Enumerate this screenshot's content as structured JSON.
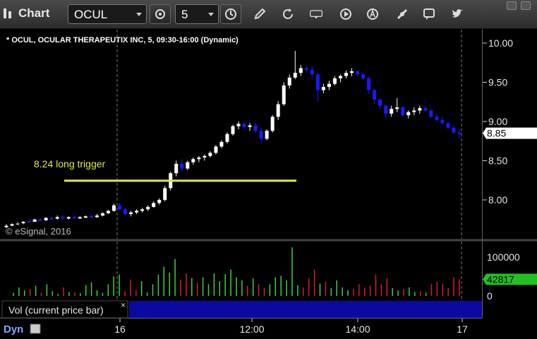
{
  "toolbar": {
    "title": "Chart",
    "symbol": "OCUL",
    "interval": "5"
  },
  "chart": {
    "header": "* OCUL, OCULAR THERAPEUTIX INC, 5, 09:30-16:00 (Dynamic)",
    "copyright": "© eSignal, 2016",
    "annotation": "8.24 long trigger",
    "last_price_label": "8.85",
    "volume_pane_label": "Vol (current price bar)",
    "last_volume_label": "42817",
    "dyn_label": "Dyn",
    "close_x": "×"
  },
  "colors": {
    "up": "#ffffff",
    "down": "#1a1aff",
    "doji": "#aaaaaa",
    "vol_up": "#3fcf3f",
    "vol_down": "#d42020",
    "trigger": "#e4ec3a",
    "badge_vol": "#22c022"
  },
  "chart_data": [
    {
      "type": "candlestick",
      "price_axis": {
        "ticks": [
          "10.00",
          "9.50",
          "9.00",
          "8.50",
          "8.00"
        ],
        "ylim": [
          7.6,
          10.1
        ]
      },
      "time_axis": {
        "ticks": [
          "16",
          "12:00",
          "14:00",
          "17"
        ]
      },
      "trigger_level": 8.24,
      "bars": [
        {
          "o": 7.66,
          "h": 7.69,
          "l": 7.64,
          "c": 7.67
        },
        {
          "o": 7.68,
          "h": 7.7,
          "l": 7.66,
          "c": 7.69
        },
        {
          "o": 7.7,
          "h": 7.72,
          "l": 7.68,
          "c": 7.7
        },
        {
          "o": 7.71,
          "h": 7.73,
          "l": 7.69,
          "c": 7.72
        },
        {
          "o": 7.73,
          "h": 7.75,
          "l": 7.71,
          "c": 7.72
        },
        {
          "o": 7.72,
          "h": 7.76,
          "l": 7.72,
          "c": 7.75
        },
        {
          "o": 7.75,
          "h": 7.77,
          "l": 7.73,
          "c": 7.74
        },
        {
          "o": 7.74,
          "h": 7.78,
          "l": 7.73,
          "c": 7.77
        },
        {
          "o": 7.77,
          "h": 7.79,
          "l": 7.75,
          "c": 7.76
        },
        {
          "o": 7.76,
          "h": 7.8,
          "l": 7.75,
          "c": 7.78
        },
        {
          "o": 7.78,
          "h": 7.8,
          "l": 7.76,
          "c": 7.77
        },
        {
          "o": 7.77,
          "h": 7.79,
          "l": 7.75,
          "c": 7.78
        },
        {
          "o": 7.78,
          "h": 7.8,
          "l": 7.77,
          "c": 7.77
        },
        {
          "o": 7.77,
          "h": 7.79,
          "l": 7.76,
          "c": 7.78
        },
        {
          "o": 7.78,
          "h": 7.8,
          "l": 7.77,
          "c": 7.79
        },
        {
          "o": 7.79,
          "h": 7.81,
          "l": 7.77,
          "c": 7.78
        },
        {
          "o": 7.78,
          "h": 7.82,
          "l": 7.77,
          "c": 7.8
        },
        {
          "o": 7.8,
          "h": 7.84,
          "l": 7.79,
          "c": 7.83
        },
        {
          "o": 7.83,
          "h": 7.87,
          "l": 7.82,
          "c": 7.86
        },
        {
          "o": 7.86,
          "h": 7.95,
          "l": 7.85,
          "c": 7.93
        },
        {
          "o": 7.93,
          "h": 7.96,
          "l": 7.86,
          "c": 7.88
        },
        {
          "o": 7.88,
          "h": 7.9,
          "l": 7.8,
          "c": 7.82
        },
        {
          "o": 7.82,
          "h": 7.86,
          "l": 7.79,
          "c": 7.84
        },
        {
          "o": 7.84,
          "h": 7.88,
          "l": 7.82,
          "c": 7.86
        },
        {
          "o": 7.86,
          "h": 7.9,
          "l": 7.84,
          "c": 7.88
        },
        {
          "o": 7.88,
          "h": 7.93,
          "l": 7.86,
          "c": 7.91
        },
        {
          "o": 7.91,
          "h": 7.98,
          "l": 7.9,
          "c": 7.96
        },
        {
          "o": 7.96,
          "h": 8.02,
          "l": 7.94,
          "c": 8.0
        },
        {
          "o": 8.0,
          "h": 8.18,
          "l": 7.98,
          "c": 8.15
        },
        {
          "o": 8.15,
          "h": 8.36,
          "l": 8.12,
          "c": 8.34
        },
        {
          "o": 8.34,
          "h": 8.5,
          "l": 8.3,
          "c": 8.46
        },
        {
          "o": 8.46,
          "h": 8.52,
          "l": 8.36,
          "c": 8.4
        },
        {
          "o": 8.4,
          "h": 8.5,
          "l": 8.38,
          "c": 8.48
        },
        {
          "o": 8.48,
          "h": 8.54,
          "l": 8.45,
          "c": 8.52
        },
        {
          "o": 8.52,
          "h": 8.56,
          "l": 8.48,
          "c": 8.54
        },
        {
          "o": 8.54,
          "h": 8.58,
          "l": 8.5,
          "c": 8.56
        },
        {
          "o": 8.56,
          "h": 8.62,
          "l": 8.54,
          "c": 8.6
        },
        {
          "o": 8.6,
          "h": 8.7,
          "l": 8.58,
          "c": 8.68
        },
        {
          "o": 8.68,
          "h": 8.76,
          "l": 8.66,
          "c": 8.74
        },
        {
          "o": 8.74,
          "h": 8.86,
          "l": 8.72,
          "c": 8.84
        },
        {
          "o": 8.84,
          "h": 8.96,
          "l": 8.82,
          "c": 8.94
        },
        {
          "o": 8.94,
          "h": 9.0,
          "l": 8.9,
          "c": 8.97
        },
        {
          "o": 8.97,
          "h": 9.0,
          "l": 8.9,
          "c": 8.93
        },
        {
          "o": 8.93,
          "h": 8.98,
          "l": 8.88,
          "c": 8.95
        },
        {
          "o": 8.95,
          "h": 8.98,
          "l": 8.86,
          "c": 8.88
        },
        {
          "o": 8.88,
          "h": 8.92,
          "l": 8.72,
          "c": 8.78
        },
        {
          "o": 8.78,
          "h": 8.9,
          "l": 8.76,
          "c": 8.88
        },
        {
          "o": 8.88,
          "h": 9.08,
          "l": 8.86,
          "c": 9.06
        },
        {
          "o": 9.06,
          "h": 9.26,
          "l": 9.02,
          "c": 9.22
        },
        {
          "o": 9.22,
          "h": 9.5,
          "l": 9.2,
          "c": 9.46
        },
        {
          "o": 9.46,
          "h": 9.6,
          "l": 9.42,
          "c": 9.56
        },
        {
          "o": 9.56,
          "h": 9.9,
          "l": 9.54,
          "c": 9.62
        },
        {
          "o": 9.62,
          "h": 9.72,
          "l": 9.58,
          "c": 9.68
        },
        {
          "o": 9.68,
          "h": 9.72,
          "l": 9.62,
          "c": 9.66
        },
        {
          "o": 9.66,
          "h": 9.7,
          "l": 9.56,
          "c": 9.6
        },
        {
          "o": 9.6,
          "h": 9.62,
          "l": 9.25,
          "c": 9.4
        },
        {
          "o": 9.4,
          "h": 9.48,
          "l": 9.36,
          "c": 9.44
        },
        {
          "o": 9.44,
          "h": 9.52,
          "l": 9.4,
          "c": 9.48
        },
        {
          "o": 9.48,
          "h": 9.58,
          "l": 9.46,
          "c": 9.55
        },
        {
          "o": 9.55,
          "h": 9.6,
          "l": 9.5,
          "c": 9.58
        },
        {
          "o": 9.58,
          "h": 9.65,
          "l": 9.55,
          "c": 9.62
        },
        {
          "o": 9.62,
          "h": 9.68,
          "l": 9.58,
          "c": 9.64
        },
        {
          "o": 9.64,
          "h": 9.66,
          "l": 9.58,
          "c": 9.6
        },
        {
          "o": 9.6,
          "h": 9.64,
          "l": 9.52,
          "c": 9.55
        },
        {
          "o": 9.55,
          "h": 9.58,
          "l": 9.35,
          "c": 9.4
        },
        {
          "o": 9.4,
          "h": 9.42,
          "l": 9.22,
          "c": 9.28
        },
        {
          "o": 9.28,
          "h": 9.3,
          "l": 9.15,
          "c": 9.2
        },
        {
          "o": 9.2,
          "h": 9.22,
          "l": 9.04,
          "c": 9.1
        },
        {
          "o": 9.1,
          "h": 9.2,
          "l": 9.06,
          "c": 9.16
        },
        {
          "o": 9.16,
          "h": 9.3,
          "l": 9.12,
          "c": 9.18
        },
        {
          "o": 9.18,
          "h": 9.2,
          "l": 9.05,
          "c": 9.08
        },
        {
          "o": 9.08,
          "h": 9.14,
          "l": 9.04,
          "c": 9.12
        },
        {
          "o": 9.12,
          "h": 9.18,
          "l": 9.08,
          "c": 9.14
        },
        {
          "o": 9.14,
          "h": 9.2,
          "l": 9.1,
          "c": 9.17
        },
        {
          "o": 9.17,
          "h": 9.2,
          "l": 9.12,
          "c": 9.14
        },
        {
          "o": 9.14,
          "h": 9.16,
          "l": 9.04,
          "c": 9.06
        },
        {
          "o": 9.06,
          "h": 9.1,
          "l": 9.0,
          "c": 9.02
        },
        {
          "o": 9.02,
          "h": 9.06,
          "l": 8.96,
          "c": 8.98
        },
        {
          "o": 8.98,
          "h": 9.0,
          "l": 8.9,
          "c": 8.92
        },
        {
          "o": 8.92,
          "h": 8.95,
          "l": 8.84,
          "c": 8.86
        },
        {
          "o": 8.86,
          "h": 8.9,
          "l": 8.78,
          "c": 8.85
        }
      ],
      "volume_axis": {
        "ticks": [
          "100000",
          "0"
        ],
        "ylim": [
          0,
          125000
        ]
      },
      "volume": [
        {
          "v": 8000,
          "up": true
        },
        {
          "v": 22000,
          "up": true
        },
        {
          "v": 14000,
          "up": true
        },
        {
          "v": 18000,
          "up": false
        },
        {
          "v": 26000,
          "up": true
        },
        {
          "v": 8000,
          "up": false
        },
        {
          "v": 30000,
          "up": true
        },
        {
          "v": 12000,
          "up": true
        },
        {
          "v": 5000,
          "up": true
        },
        {
          "v": 22000,
          "up": false
        },
        {
          "v": 10000,
          "up": true
        },
        {
          "v": 9000,
          "up": false
        },
        {
          "v": 7000,
          "up": true
        },
        {
          "v": 28000,
          "up": true
        },
        {
          "v": 35000,
          "up": true
        },
        {
          "v": 15000,
          "up": true
        },
        {
          "v": 8000,
          "up": true
        },
        {
          "v": 30000,
          "up": true
        },
        {
          "v": 50000,
          "up": true
        },
        {
          "v": 55000,
          "up": true
        },
        {
          "v": 12000,
          "up": false
        },
        {
          "v": 42000,
          "up": false
        },
        {
          "v": 15000,
          "up": false
        },
        {
          "v": 38000,
          "up": true
        },
        {
          "v": 9000,
          "up": true
        },
        {
          "v": 30000,
          "up": true
        },
        {
          "v": 55000,
          "up": true
        },
        {
          "v": 75000,
          "up": true
        },
        {
          "v": 60000,
          "up": true
        },
        {
          "v": 95000,
          "up": true
        },
        {
          "v": 42000,
          "up": false
        },
        {
          "v": 58000,
          "up": false
        },
        {
          "v": 46000,
          "up": true
        },
        {
          "v": 34000,
          "up": false
        },
        {
          "v": 48000,
          "up": true
        },
        {
          "v": 30000,
          "up": true
        },
        {
          "v": 58000,
          "up": true
        },
        {
          "v": 38000,
          "up": true
        },
        {
          "v": 56000,
          "up": true
        },
        {
          "v": 68000,
          "up": true
        },
        {
          "v": 48000,
          "up": true
        },
        {
          "v": 40000,
          "up": true
        },
        {
          "v": 26000,
          "up": false
        },
        {
          "v": 45000,
          "up": true
        },
        {
          "v": 30000,
          "up": false
        },
        {
          "v": 20000,
          "up": false
        },
        {
          "v": 30000,
          "up": true
        },
        {
          "v": 48000,
          "up": true
        },
        {
          "v": 52000,
          "up": true
        },
        {
          "v": 40000,
          "up": true
        },
        {
          "v": 125000,
          "up": true
        },
        {
          "v": 28000,
          "up": true
        },
        {
          "v": 22000,
          "up": false
        },
        {
          "v": 45000,
          "up": false
        },
        {
          "v": 68000,
          "up": false
        },
        {
          "v": 32000,
          "up": true
        },
        {
          "v": 36000,
          "up": false
        },
        {
          "v": 20000,
          "up": true
        },
        {
          "v": 40000,
          "up": true
        },
        {
          "v": 22000,
          "up": true
        },
        {
          "v": 15000,
          "up": true
        },
        {
          "v": 18000,
          "up": false
        },
        {
          "v": 30000,
          "up": false
        },
        {
          "v": 22000,
          "up": false
        },
        {
          "v": 26000,
          "up": false
        },
        {
          "v": 55000,
          "up": false
        },
        {
          "v": 30000,
          "up": false
        },
        {
          "v": 45000,
          "up": false
        },
        {
          "v": 20000,
          "up": true
        },
        {
          "v": 14000,
          "up": true
        },
        {
          "v": 18000,
          "up": false
        },
        {
          "v": 22000,
          "up": true
        },
        {
          "v": 10000,
          "up": true
        },
        {
          "v": 12000,
          "up": false
        },
        {
          "v": 8000,
          "up": true
        },
        {
          "v": 30000,
          "up": false
        },
        {
          "v": 36000,
          "up": false
        },
        {
          "v": 30000,
          "up": false
        },
        {
          "v": 20000,
          "up": false
        },
        {
          "v": 48000,
          "up": false
        },
        {
          "v": 42817,
          "up": false
        }
      ]
    }
  ]
}
